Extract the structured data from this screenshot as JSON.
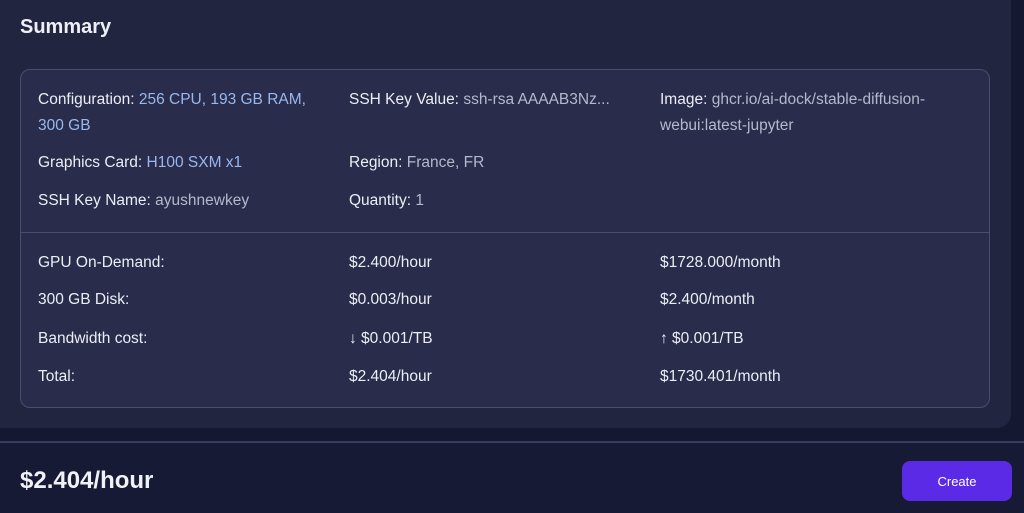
{
  "summary": {
    "title": "Summary",
    "config": {
      "configuration_label": "Configuration:",
      "configuration_value_line1": "256 CPU, 193 GB RAM,",
      "configuration_value_line2": "300 GB",
      "ssh_key_value_label": "SSH Key Value:",
      "ssh_key_value": "ssh-rsa AAAAB3Nz...",
      "image_label": "Image:",
      "image_value_line1": "ghcr.io/ai-dock/stable-diffusion-",
      "image_value_line2": "webui:latest-jupyter",
      "graphics_label": "Graphics Card:",
      "graphics_value": "H100 SXM x1",
      "region_label": "Region:",
      "region_value": "France, FR",
      "ssh_key_name_label": "SSH Key Name:",
      "ssh_key_name_value": "ayushnewkey",
      "quantity_label": "Quantity:",
      "quantity_value": "1"
    },
    "costs": [
      {
        "label": "GPU On-Demand:",
        "hourly": "$2.400/hour",
        "monthly": "$1728.000/month"
      },
      {
        "label": "300 GB Disk:",
        "hourly": "$0.003/hour",
        "monthly": "$2.400/month"
      },
      {
        "label": "Bandwidth cost:",
        "hourly": "↓ $0.001/TB",
        "monthly": "↑ $0.001/TB"
      },
      {
        "label": "Total:",
        "hourly": "$2.404/hour",
        "monthly": "$1730.401/month"
      }
    ]
  },
  "footer": {
    "price": "$2.404/hour",
    "create_label": "Create"
  },
  "colors": {
    "accent_button": "#5b2ae6",
    "link_value": "#99b8ee",
    "muted_value": "#b5b9cc"
  }
}
